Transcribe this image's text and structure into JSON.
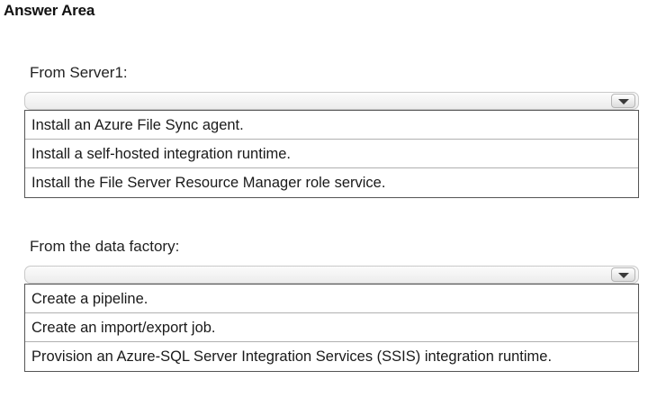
{
  "title": "Answer Area",
  "groups": [
    {
      "label": "From Server1:",
      "selected": "",
      "options": [
        "Install an Azure File Sync agent.",
        "Install a self-hosted integration runtime.",
        "Install the File Server Resource Manager role service."
      ]
    },
    {
      "label": "From the data factory:",
      "selected": "",
      "options": [
        "Create a pipeline.",
        "Create an import/export job.",
        "Provision an Azure-SQL Server Integration Services (SSIS) integration runtime."
      ]
    }
  ],
  "icons": {
    "dropdown": "chevron-down-icon"
  }
}
